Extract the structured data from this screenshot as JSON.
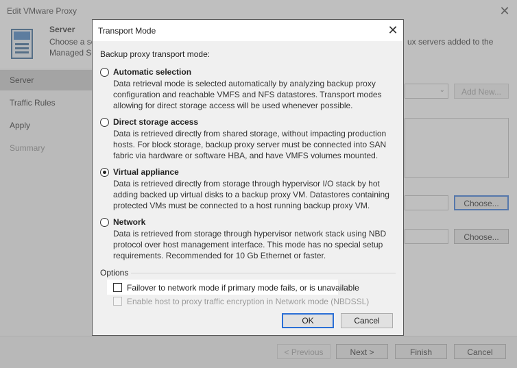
{
  "background": {
    "window_title": "Edit VMware Proxy",
    "close_glyph": "✕",
    "header": {
      "title": "Server",
      "desc_line1_left": "Choose a se",
      "desc_line1_right": "ux servers added to the",
      "desc_line2": "Managed Se"
    },
    "nav": [
      {
        "label": "Server"
      },
      {
        "label": "Traffic Rules"
      },
      {
        "label": "Apply"
      },
      {
        "label": "Summary"
      }
    ],
    "add_new_label": "Add New...",
    "choose1_label": "Choose...",
    "choose2_label": "Choose...",
    "footer": {
      "previous_label": "< Previous",
      "next_label": "Next >",
      "finish_label": "Finish",
      "cancel_label": "Cancel"
    }
  },
  "dialog": {
    "title": "Transport Mode",
    "close_glyph": "✕",
    "caption": "Backup proxy transport mode:",
    "modes": [
      {
        "title": "Automatic selection",
        "selected": false,
        "desc": [
          "Data retrieval mode is selected automatically by analyzing backup proxy",
          "configuration and reachable VMFS and NFS datastores. Transport modes",
          "allowing for direct storage access will be used whenever possible."
        ]
      },
      {
        "title": "Direct storage access",
        "selected": false,
        "desc": [
          "Data is retrieved directly from shared storage, without impacting production",
          "hosts. For block storage, backup proxy server must be connected into SAN",
          "fabric via hardware or software HBA, and have VMFS volumes mounted."
        ]
      },
      {
        "title": "Virtual appliance",
        "selected": true,
        "desc": [
          "Data is retrieved directly from storage through hypervisor I/O stack by hot",
          "adding backed up virtual disks to a backup proxy VM. Datastores containing",
          "protected VMs must be connected to a host running backup proxy VM."
        ]
      },
      {
        "title": "Network",
        "selected": false,
        "desc": [
          "Data is retrieved from storage through hypervisor network stack using NBD",
          "protocol over host management interface. This mode has no special setup",
          "requirements. Recommended for 10 Gb Ethernet or faster."
        ]
      }
    ],
    "options_label": "Options",
    "failover_label": "Failover to network mode if primary mode fails, or is unavailable",
    "failover_checked": false,
    "encrypt_label": "Enable host to proxy traffic encryption in Network mode (NBDSSL)",
    "encrypt_checked": false,
    "ok_label": "OK",
    "cancel_label": "Cancel"
  },
  "colors": {
    "overlay": "#808080",
    "focus_border": "#2a6fd6"
  }
}
